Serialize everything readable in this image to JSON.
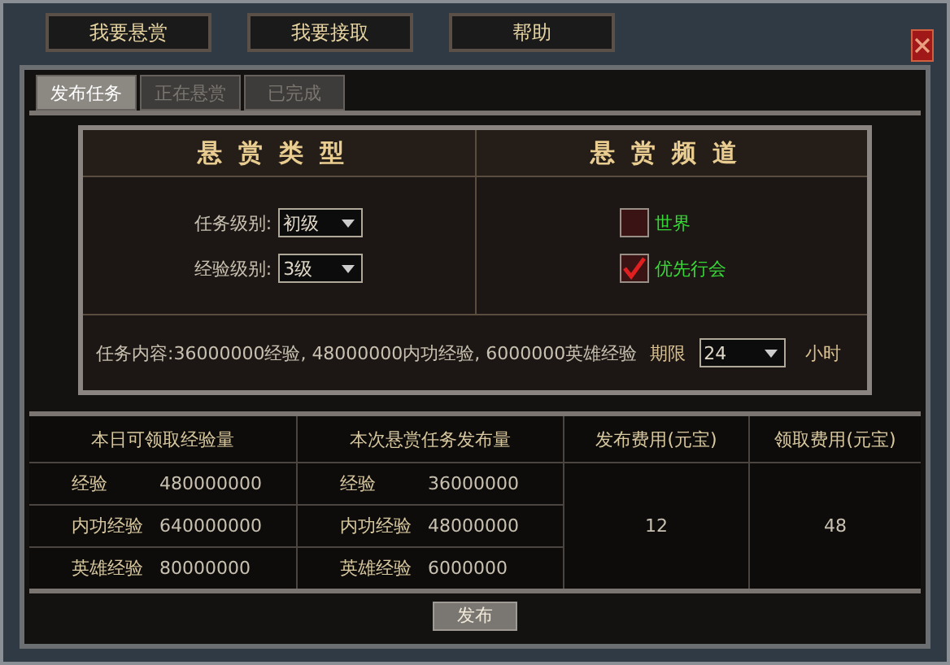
{
  "top_buttons": [
    "我要悬赏",
    "我要接取",
    "帮助"
  ],
  "tabs": [
    {
      "label": "发布任务",
      "selected": true
    },
    {
      "label": "正在悬赏",
      "selected": false
    },
    {
      "label": "已完成",
      "selected": false
    }
  ],
  "bounty_type": {
    "title": "悬赏类型",
    "fields": [
      {
        "label": "任务级别:",
        "value": "初级"
      },
      {
        "label": "经验级别:",
        "value": "3级"
      }
    ]
  },
  "bounty_channel": {
    "title": "悬赏频道",
    "options": [
      {
        "label": "世界",
        "checked": false
      },
      {
        "label": "优先行会",
        "checked": true
      }
    ]
  },
  "task_content": "任务内容:36000000经验, 48000000内功经验, 6000000英雄经验",
  "deadline": {
    "label": "期限",
    "value": "24",
    "unit": "小时"
  },
  "daily_claimable": {
    "title": "本日可领取经验量",
    "items": [
      {
        "label": "经验",
        "value": "480000000"
      },
      {
        "label": "内功经验",
        "value": "640000000"
      },
      {
        "label": "英雄经验",
        "value": "80000000"
      }
    ]
  },
  "this_bounty": {
    "title": "本次悬赏任务发布量",
    "items": [
      {
        "label": "经验",
        "value": "36000000"
      },
      {
        "label": "内功经验",
        "value": "48000000"
      },
      {
        "label": "英雄经验",
        "value": "6000000"
      }
    ]
  },
  "publish_fee": {
    "title": "发布费用(元宝)",
    "value": "12"
  },
  "claim_fee": {
    "title": "领取费用(元宝)",
    "value": "48"
  },
  "publish_button": "发布"
}
